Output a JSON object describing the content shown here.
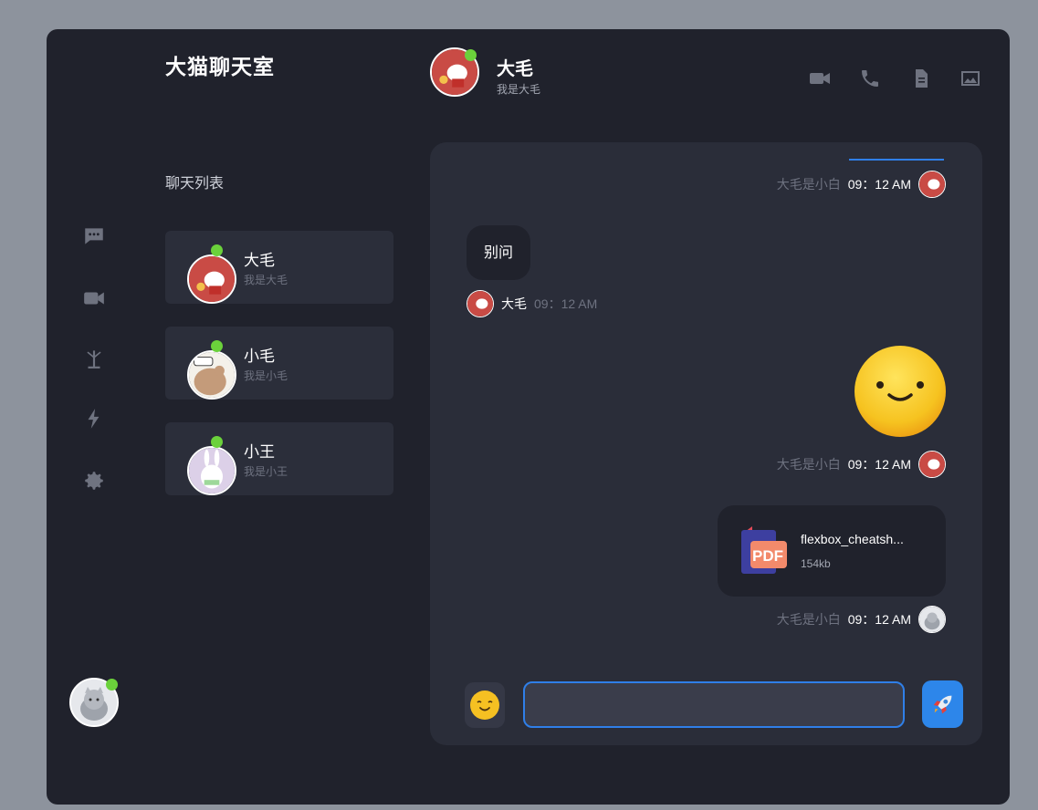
{
  "app": {
    "title": "大猫聊天室"
  },
  "rail": {
    "icons": [
      "chat-bubble-icon",
      "video-camera-icon",
      "plant-icon",
      "lightning-icon",
      "settings-gear-icon"
    ]
  },
  "contacts_section": {
    "title": "聊天列表",
    "items": [
      {
        "name": "大毛",
        "status": "我是大毛",
        "online": true
      },
      {
        "name": "小毛",
        "status": "我是小毛",
        "online": true
      },
      {
        "name": "小王",
        "status": "我是小王",
        "online": true
      }
    ]
  },
  "chat_header": {
    "name": "大毛",
    "status": "我是大毛",
    "online": true,
    "actions": [
      "video-call-icon",
      "phone-icon",
      "document-icon",
      "image-icon"
    ]
  },
  "messages": [
    {
      "kind": "meta-self",
      "who": "大毛是小白",
      "time": "09：12 AM"
    },
    {
      "kind": "text-incoming",
      "text": "别问",
      "sender": "大毛",
      "time": "09：12 AM"
    },
    {
      "kind": "emoji-outgoing",
      "emoji": "smiley-emoji-icon",
      "who": "大毛是小白",
      "time": "09：12 AM"
    },
    {
      "kind": "file-outgoing",
      "file_name": "flexbox_cheatsh...",
      "file_size": "154kb",
      "file_type": "PDF",
      "who": "大毛是小白",
      "time": "09：12 AM"
    }
  ],
  "composer": {
    "input_value": "",
    "input_placeholder": "",
    "emoji_button": "emoji-picker-icon",
    "send_button": "rocket-send-icon"
  },
  "colors": {
    "background": "#8d939d",
    "app_bg": "#20222c",
    "panel_bg": "#2a2d39",
    "card_bg": "#2b2e3a",
    "accent": "#2d86ea",
    "online": "#6bd13b"
  }
}
